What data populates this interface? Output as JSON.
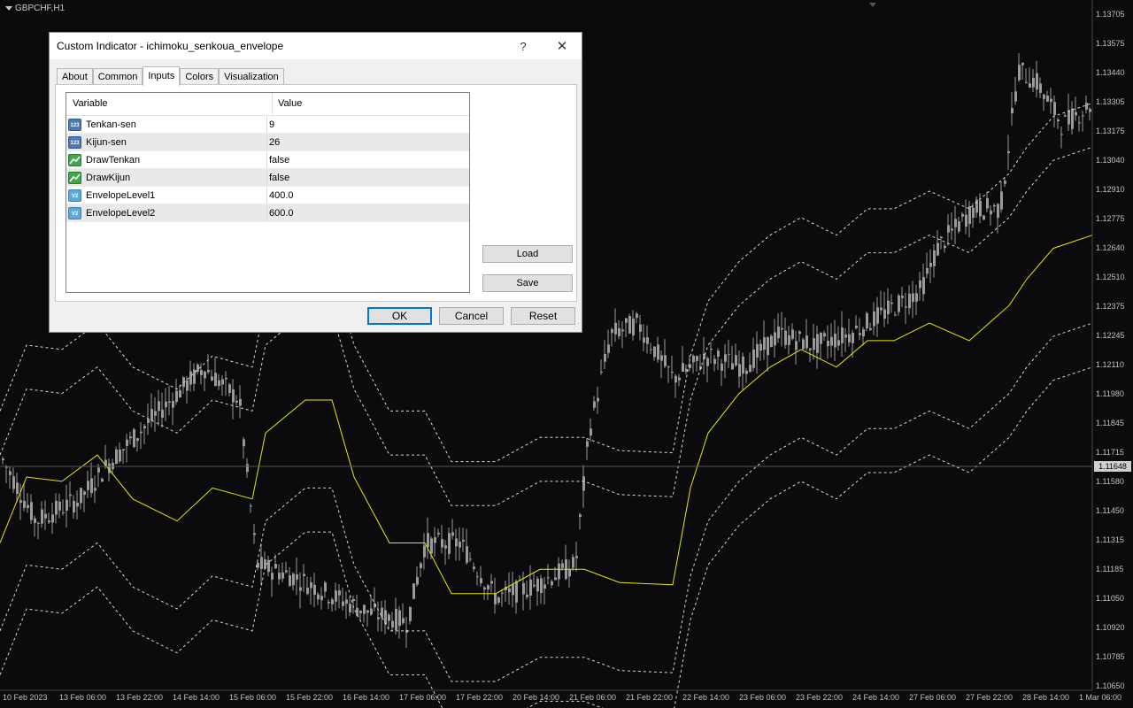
{
  "chart": {
    "symbol": "GBPCHF,H1",
    "current_price": "1.11648",
    "price_levels": [
      "1.13705",
      "1.13575",
      "1.13440",
      "1.13305",
      "1.13175",
      "1.13040",
      "1.12910",
      "1.12775",
      "1.12640",
      "1.12510",
      "1.12375",
      "1.12245",
      "1.12110",
      "1.11980",
      "1.11845",
      "1.11715",
      "1.11580",
      "1.11450",
      "1.11315",
      "1.11185",
      "1.11050",
      "1.10920",
      "1.10785",
      "1.10650"
    ],
    "time_labels": [
      "10 Feb 2023",
      "13 Feb 06:00",
      "13 Feb 22:00",
      "14 Feb 14:00",
      "15 Feb 06:00",
      "15 Feb 22:00",
      "16 Feb 14:00",
      "17 Feb 06:00",
      "17 Feb 22:00",
      "20 Feb 14:00",
      "21 Feb 06:00",
      "21 Feb 22:00",
      "22 Feb 14:00",
      "23 Feb 06:00",
      "23 Feb 22:00",
      "24 Feb 14:00",
      "27 Feb 06:00",
      "27 Feb 22:00",
      "28 Feb 14:00",
      "1 Mar 06:00"
    ],
    "colors": {
      "background": "#0b0b0e",
      "candle": "#9a9a9a",
      "indicator": "#e8e800",
      "envelope": "#d8d8d8"
    }
  },
  "dialog": {
    "title": "Custom Indicator - ichimoku_senkoua_envelope",
    "help_label": "?",
    "close_label": "✕",
    "tabs": [
      {
        "label": "About",
        "active": false
      },
      {
        "label": "Common",
        "active": false
      },
      {
        "label": "Inputs",
        "active": true
      },
      {
        "label": "Colors",
        "active": false
      },
      {
        "label": "Visualization",
        "active": false
      }
    ],
    "grid": {
      "col_variable": "Variable",
      "col_value": "Value",
      "rows": [
        {
          "icon": "int",
          "icon_text": "123",
          "variable": "Tenkan-sen",
          "value": "9"
        },
        {
          "icon": "int",
          "icon_text": "123",
          "variable": "Kijun-sen",
          "value": "26"
        },
        {
          "icon": "bool",
          "icon_text": "",
          "variable": "DrawTenkan",
          "value": "false"
        },
        {
          "icon": "bool",
          "icon_text": "",
          "variable": "DrawKijun",
          "value": "false"
        },
        {
          "icon": "dbl",
          "icon_text": "V2",
          "variable": "EnvelopeLevel1",
          "value": "400.0"
        },
        {
          "icon": "dbl",
          "icon_text": "V2",
          "variable": "EnvelopeLevel2",
          "value": "600.0"
        }
      ]
    },
    "buttons": {
      "load": "Load",
      "save": "Save",
      "ok": "OK",
      "cancel": "Cancel",
      "reset": "Reset"
    }
  }
}
